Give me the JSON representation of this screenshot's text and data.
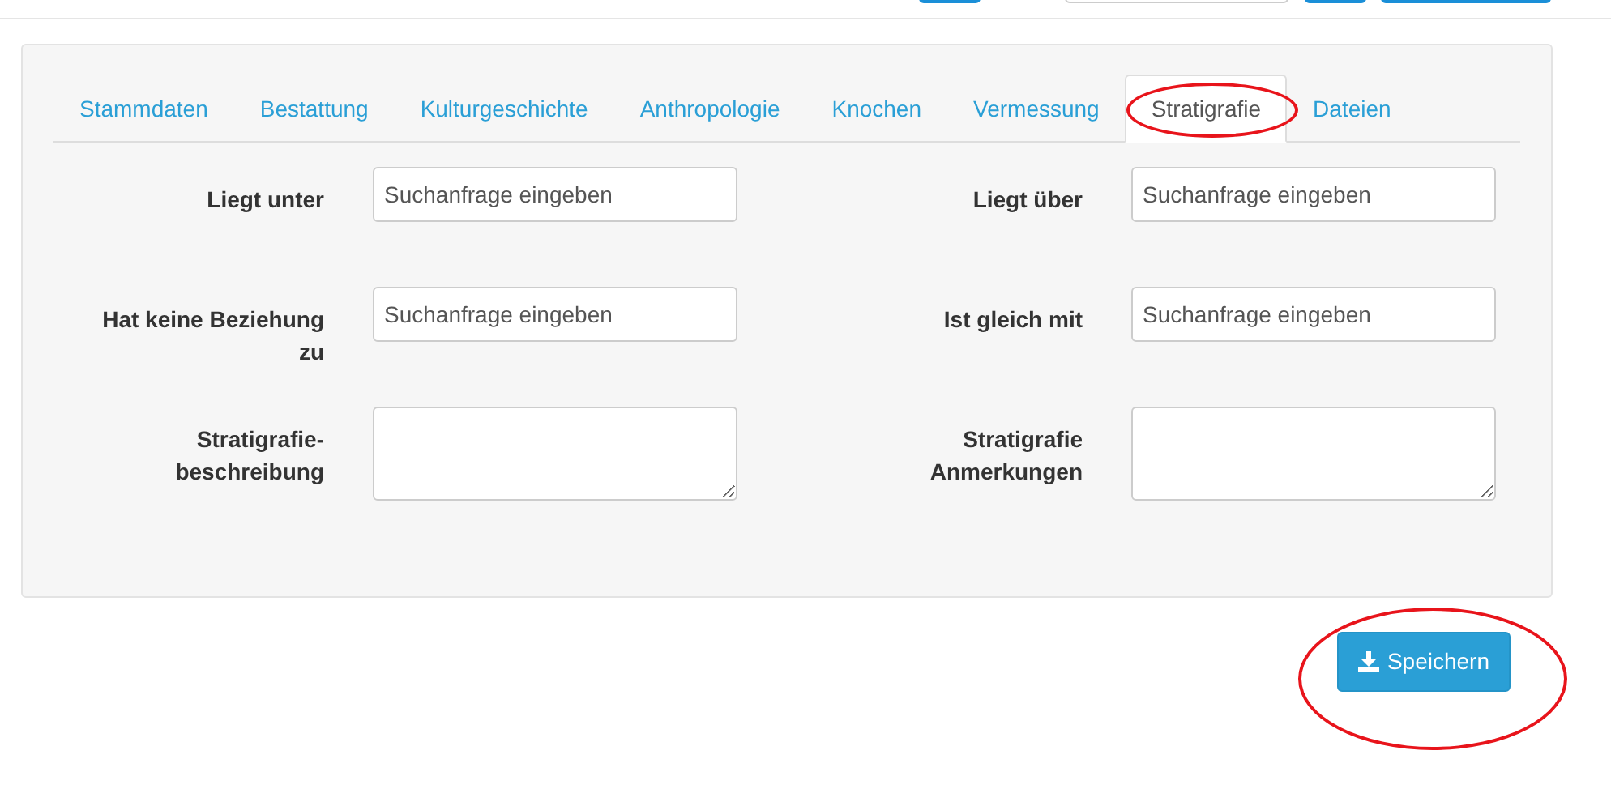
{
  "tabs": [
    {
      "label": "Stammdaten",
      "selected": false,
      "circled": false
    },
    {
      "label": "Bestattung",
      "selected": false,
      "circled": false
    },
    {
      "label": "Kulturgeschichte",
      "selected": false,
      "circled": false
    },
    {
      "label": "Anthropologie",
      "selected": false,
      "circled": false
    },
    {
      "label": "Knochen",
      "selected": false,
      "circled": false
    },
    {
      "label": "Vermessung",
      "selected": false,
      "circled": false
    },
    {
      "label": "Stratigrafie",
      "selected": true,
      "circled": true
    },
    {
      "label": "Dateien",
      "selected": false,
      "circled": false
    }
  ],
  "fields": [
    {
      "label": "Liegt unter",
      "kind": "input",
      "placeholder": "Suchanfrage eingeben"
    },
    {
      "label": "Liegt über",
      "kind": "input",
      "placeholder": "Suchanfrage eingeben"
    },
    {
      "label": "Hat keine Beziehung zu",
      "kind": "input",
      "placeholder": "Suchanfrage eingeben"
    },
    {
      "label": "Ist gleich mit",
      "kind": "input",
      "placeholder": "Suchanfrage eingeben"
    },
    {
      "label": "Stratigrafie-beschreibung",
      "kind": "textarea"
    },
    {
      "label": "Stratigrafie Anmerkungen",
      "kind": "textarea"
    }
  ],
  "save_button": {
    "label": "Speichern",
    "circled": true
  }
}
